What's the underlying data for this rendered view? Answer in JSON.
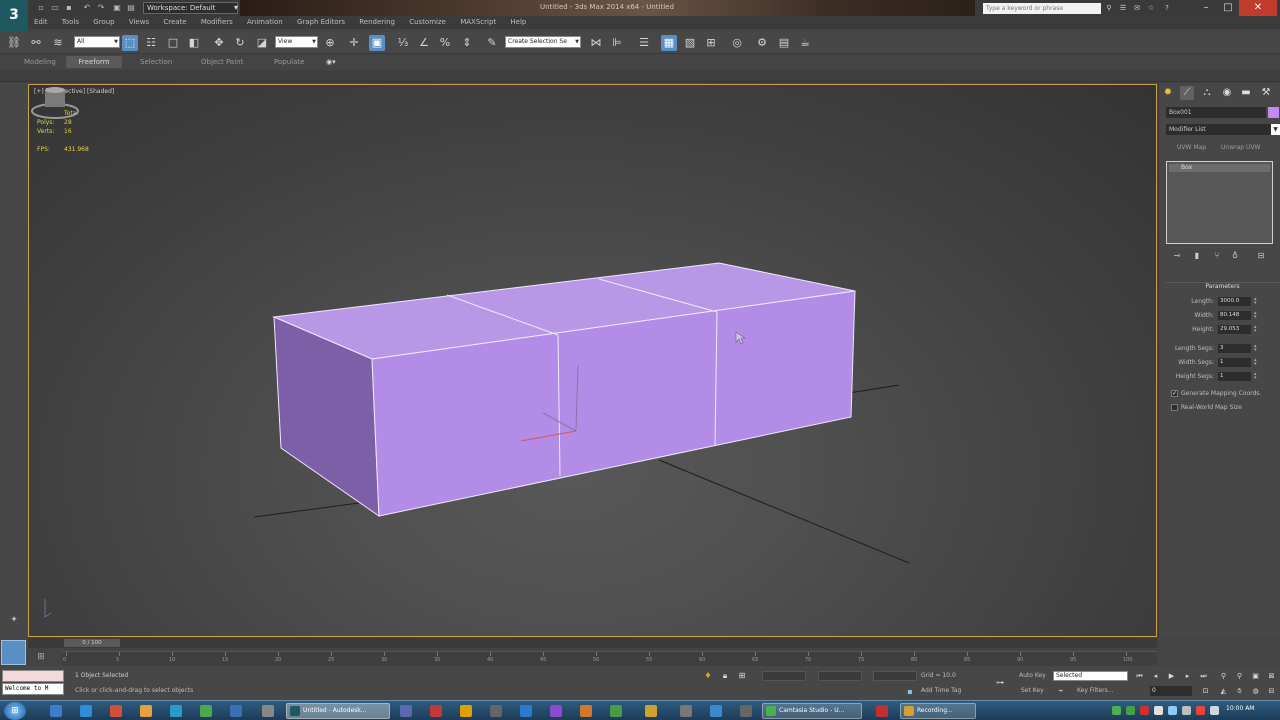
{
  "titlebar": {
    "workspace": "Workspace: Default",
    "window_title": "Untitled - 3ds Max 2014 x64 - Untitled",
    "search_placeholder": "Type a keyword or phrase"
  },
  "menu": [
    "Edit",
    "Tools",
    "Group",
    "Views",
    "Create",
    "Modifiers",
    "Animation",
    "Graph Editors",
    "Rendering",
    "Customize",
    "MAXScript",
    "Help"
  ],
  "toolbar": {
    "filter_select": "All",
    "refcoord_select": "View",
    "named_selection": "Create Selection Se"
  },
  "ribbon": {
    "tabs": [
      "Modeling",
      "Freeform",
      "Selection",
      "Object Paint",
      "Populate"
    ],
    "active": "Freeform"
  },
  "viewport": {
    "label": "[+] [Perspective] [Shaded]",
    "stats": {
      "header": "Total",
      "polys_label": "Polys:",
      "polys": "28",
      "verts_label": "Verts:",
      "verts": "16",
      "fps_label": "FPS:",
      "fps": "431.968"
    },
    "box_color": "#b28ce6",
    "wire_color": "#f0e8ff"
  },
  "command_panel": {
    "object_name": "Box001",
    "object_color": "#c28bf2",
    "modifier_list": "Modifier List",
    "uvw_map": "UVW Map",
    "unwrap_uvw": "Unwrap UVW",
    "stack_items": [
      "Box"
    ],
    "params_title": "Parameters",
    "params": [
      {
        "label": "Length:",
        "value": "3000.0"
      },
      {
        "label": "Width:",
        "value": "80.148"
      },
      {
        "label": "Height:",
        "value": "29.053"
      },
      {
        "label": "Length Segs:",
        "value": "3"
      },
      {
        "label": "Width Segs:",
        "value": "1"
      },
      {
        "label": "Height Segs:",
        "value": "1"
      }
    ],
    "gen_mapping": "Generate Mapping Coords.",
    "real_world": "Real-World Map Size"
  },
  "timeline": {
    "frame_display": "0 / 100",
    "ticks": [
      "0",
      "5",
      "10",
      "15",
      "20",
      "25",
      "30",
      "35",
      "40",
      "45",
      "50",
      "55",
      "60",
      "65",
      "70",
      "75",
      "80",
      "85",
      "90",
      "95",
      "100"
    ]
  },
  "status": {
    "maxscript_hint": "Welcome to M",
    "selection": "1 Object Selected",
    "prompt": "Click or click-and-drag to select objects",
    "grid": "Grid = 10.0",
    "add_time_tag": "Add Time Tag",
    "auto_key": "Auto Key",
    "set_key": "Set Key",
    "selected_dd": "Selected",
    "key_filters": "Key Filters...",
    "frame": "0"
  },
  "taskbar": {
    "tasks": [
      "Untitled - Autodesk...",
      "Camtasia Studio - U...",
      "Recording..."
    ],
    "clock": "10:00 AM"
  }
}
